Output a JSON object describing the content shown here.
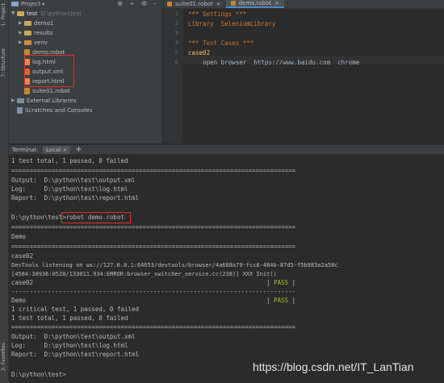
{
  "sidebar_labels": {
    "project": "1: Project",
    "structure": "7: Structure",
    "favorites": "2: Favorites"
  },
  "project_panel": {
    "title": "Project",
    "root": {
      "name": "test",
      "path": "D:\\python\\test"
    },
    "items": [
      {
        "name": "demo1",
        "kind": "folder"
      },
      {
        "name": "results",
        "kind": "folder"
      },
      {
        "name": "venv",
        "kind": "folder"
      },
      {
        "name": "demo.robot",
        "kind": "robot"
      },
      {
        "name": "log.html",
        "kind": "html"
      },
      {
        "name": "output.xml",
        "kind": "xml"
      },
      {
        "name": "report.html",
        "kind": "html"
      },
      {
        "name": "suite01.robot",
        "kind": "robot"
      }
    ],
    "external": "External Libraries",
    "scratches": "Scratches and Consoles"
  },
  "editor": {
    "tabs": [
      {
        "label": "suite01.robot"
      },
      {
        "label": "demo.robot"
      }
    ],
    "line_numbers": [
      "1",
      "2",
      "3",
      "4",
      "5",
      "6"
    ],
    "lines": [
      "*** Settings ***",
      "Library  SeleniumLibrary",
      "",
      "*** Test Cases ***",
      "case02",
      "    open browser  https://www.baidu.com  chrome"
    ]
  },
  "terminal": {
    "label": "Terminal:",
    "tab": "Local",
    "add": "+",
    "lines": [
      "1 test total, 1 passed, 0 failed",
      "==============================================================================",
      "Output:  D:\\python\\test\\output.xml",
      "Log:     D:\\python\\test\\log.html",
      "Report:  D:\\python\\test\\report.html",
      "",
      "D:\\python\\test>robot demo.robot",
      "==============================================================================",
      "Demo",
      "==============================================================================",
      "case02",
      "DevTools listening on ws://127.0.0.1:64653/devtools/browser/4a688a79-fcc8-484b-87d5-f5b983a2a58c",
      "[4584:38936:0528/133011.934:ERROR:browser_switcher_service.cc(238)] XXX Init()",
      "case02                                                                | PASS |",
      "------------------------------------------------------------------------------",
      "Demo                                                                  | PASS |",
      "1 critical test, 1 passed, 0 failed",
      "1 test total, 1 passed, 0 failed",
      "==============================================================================",
      "Output:  D:\\python\\test\\output.xml",
      "Log:     D:\\python\\test\\log.html",
      "Report:  D:\\python\\test\\report.html",
      "",
      "D:\\python\\test>"
    ]
  },
  "watermark": "https://blog.csdn.net/IT_LanTian",
  "colors": {
    "heading": "#cc7832",
    "setting": "#cc7832",
    "library": "#a9b7c6",
    "keyword": "#ffc66d",
    "url": "#6a8759",
    "pass": "#a8c023",
    "highlight_box": "#e03030"
  }
}
